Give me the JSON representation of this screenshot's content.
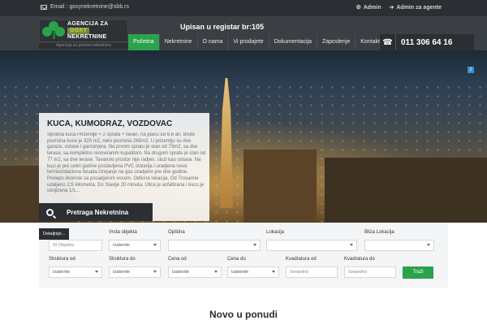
{
  "topbar": {
    "email": "Email : goxynekretnine@sbb.rs",
    "admin_label": "Admin",
    "admin_agent_label": "Admin za agente"
  },
  "header": {
    "logo_line1": "AGENCIJA ZA",
    "logo_line2": "GOXY",
    "logo_line3": "NEKRETNINE",
    "logo_sub": "Agencija za promet nekretnina",
    "registry": "Upisan u registar br:105",
    "phone": "011 306 64 16"
  },
  "nav": {
    "items": [
      "Početna",
      "Nekretnine",
      "O nama",
      "Vi prodajete",
      "Dokumentacija",
      "Zaposlenje",
      "Kontakt"
    ],
    "active_index": 0
  },
  "hero": {
    "badge": "2",
    "listing_title": "KUCA, KUMODRAZ, VOZDOVAC",
    "listing_desc": "Spratna kuca Prizemlje + 2 sprata + tavan, na placu od 6,6 ari. Bruto povrsina kuce je 325 m2, neto povrsina 265m2. U prizemlju su dve garaze, ostave i garsonjera. Na prvom spratu je stan od 73m2, sa dve terase, sa kompletno renoviranim kupatilom. Na drugom spratu je stan od 77 m2, sa dve terase. Tavanski prostor nije radjen, sluzi kao ostava. Na kuci je pre cetiri godine postavljena PVC stolarija i uradjena nova termoizolaciona fasada.Grejanje na gas uradjeno pre dve godine. Prelepo dvoriste sa posadjenim vocem. Odlicna lokacija, Od Trosarine udaljeno 2,5 kilometra. Do Slavije 20 minuta. Ulica je asfaltirana i kucu je uknjizena 1/1...",
    "search_label": "Pretraga Nekretnina"
  },
  "form": {
    "detaljnije": "Detaljnije...",
    "id_label": "",
    "id_placeholder": "ID Objekta",
    "vrsta_label": "Vrsta objekta",
    "vrsta_value": "Izaberite",
    "opstina_label": "Opština",
    "opstina_value": "",
    "lokacija_label": "Lokacija",
    "lokacija_value": "",
    "bliza_label": "Bliza Lokacija",
    "bliza_value": "",
    "struktura_od_label": "Struktura od",
    "struktura_od_value": "Izaberite",
    "struktura_do_label": "Struktura do",
    "struktura_do_value": "Izaberite",
    "cena_od_label": "Cena od",
    "cena_od_value": "Izaberite",
    "cena_do_label": "Cena do",
    "cena_do_value": "Izaberite",
    "kvadratura_od_label": "Kvadratura od",
    "kvadratura_od_placeholder": "Svejedno",
    "kvadratura_do_label": "Kvadratura do",
    "kvadratura_do_placeholder": "Svejedno",
    "submit_label": "Traži"
  },
  "section": {
    "title": "Novo u ponudi"
  },
  "colors": {
    "accent": "#2ba24c",
    "dark": "#2b2f33",
    "header": "#3a3f44"
  }
}
